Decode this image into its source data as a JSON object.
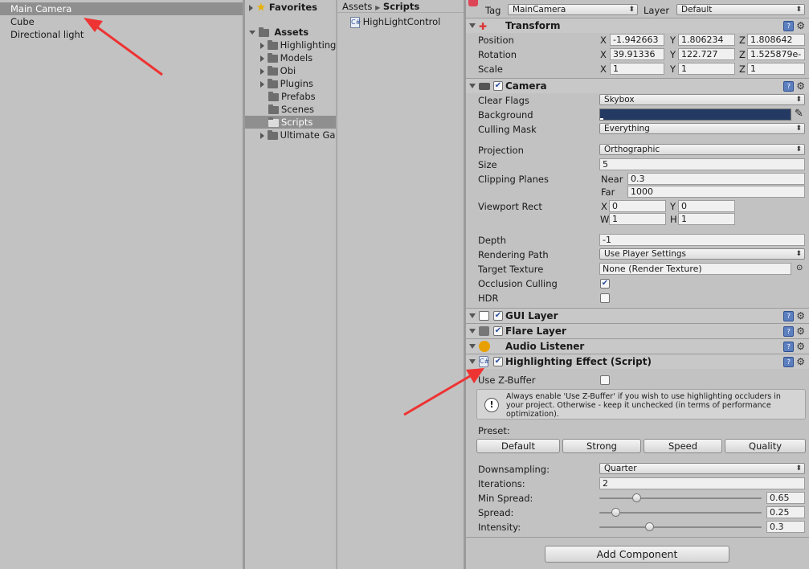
{
  "hierarchy": {
    "items": [
      {
        "label": "Main Camera",
        "selected": true
      },
      {
        "label": "Cube",
        "selected": false
      },
      {
        "label": "Directional light",
        "selected": false
      }
    ]
  },
  "project": {
    "favorites_label": "Favorites",
    "assets_label": "Assets",
    "folders": [
      "HighlightingS",
      "Models",
      "Obi",
      "Plugins",
      "Prefabs",
      "Scenes",
      "Scripts",
      "Ultimate Ga"
    ],
    "breadcrumb": {
      "root": "Assets",
      "current": "Scripts"
    },
    "files": [
      "HighLightControl"
    ]
  },
  "inspector": {
    "tag_label": "Tag",
    "tag_value": "MainCamera",
    "layer_label": "Layer",
    "layer_value": "Default",
    "transform": {
      "title": "Transform",
      "position_label": "Position",
      "rotation_label": "Rotation",
      "scale_label": "Scale",
      "position": {
        "x": "-1.942663",
        "y": "1.806234",
        "z": "1.808642"
      },
      "rotation": {
        "x": "39.91336",
        "y": "122.727",
        "z": "1.525879e-"
      },
      "scale": {
        "x": "1",
        "y": "1",
        "z": "1"
      }
    },
    "axis": {
      "x": "X",
      "y": "Y",
      "z": "Z",
      "w": "W",
      "h": "H"
    },
    "camera": {
      "title": "Camera",
      "clear_flags_label": "Clear Flags",
      "clear_flags": "Skybox",
      "background_label": "Background",
      "background_color": "#243a62",
      "culling_mask_label": "Culling Mask",
      "culling_mask": "Everything",
      "projection_label": "Projection",
      "projection": "Orthographic",
      "size_label": "Size",
      "size": "5",
      "clipping_label": "Clipping Planes",
      "near_label": "Near",
      "near": "0.3",
      "far_label": "Far",
      "far": "1000",
      "viewport_label": "Viewport Rect",
      "vp_x": "0",
      "vp_y": "0",
      "vp_w": "1",
      "vp_h": "1",
      "depth_label": "Depth",
      "depth": "-1",
      "rendering_path_label": "Rendering Path",
      "rendering_path": "Use Player Settings",
      "target_texture_label": "Target Texture",
      "target_texture": "None (Render Texture)",
      "occlusion_label": "Occlusion Culling",
      "occlusion": true,
      "hdr_label": "HDR",
      "hdr": false
    },
    "gui_layer": "GUI Layer",
    "flare_layer": "Flare Layer",
    "audio_listener": "Audio Listener",
    "highlighting": {
      "title": "Highlighting Effect (Script)",
      "zbuffer_label": "Use Z-Buffer",
      "help_text": "Always enable 'Use Z-Buffer' if you wish to use highlighting occluders in your project. Otherwise - keep it unchecked (in terms of performance optimization).",
      "preset_label": "Preset:",
      "presets": [
        "Default",
        "Strong",
        "Speed",
        "Quality"
      ],
      "downsampling_label": "Downsampling:",
      "downsampling": "Quarter",
      "iterations_label": "Iterations:",
      "iterations": "2",
      "min_spread_label": "Min Spread:",
      "min_spread": "0.65",
      "spread_label": "Spread:",
      "spread": "0.25",
      "intensity_label": "Intensity:",
      "intensity": "0.3"
    },
    "add_component": "Add Component"
  },
  "colors": {
    "annotation_arrow": "#ee3333",
    "selection": "#8f8f8f"
  }
}
